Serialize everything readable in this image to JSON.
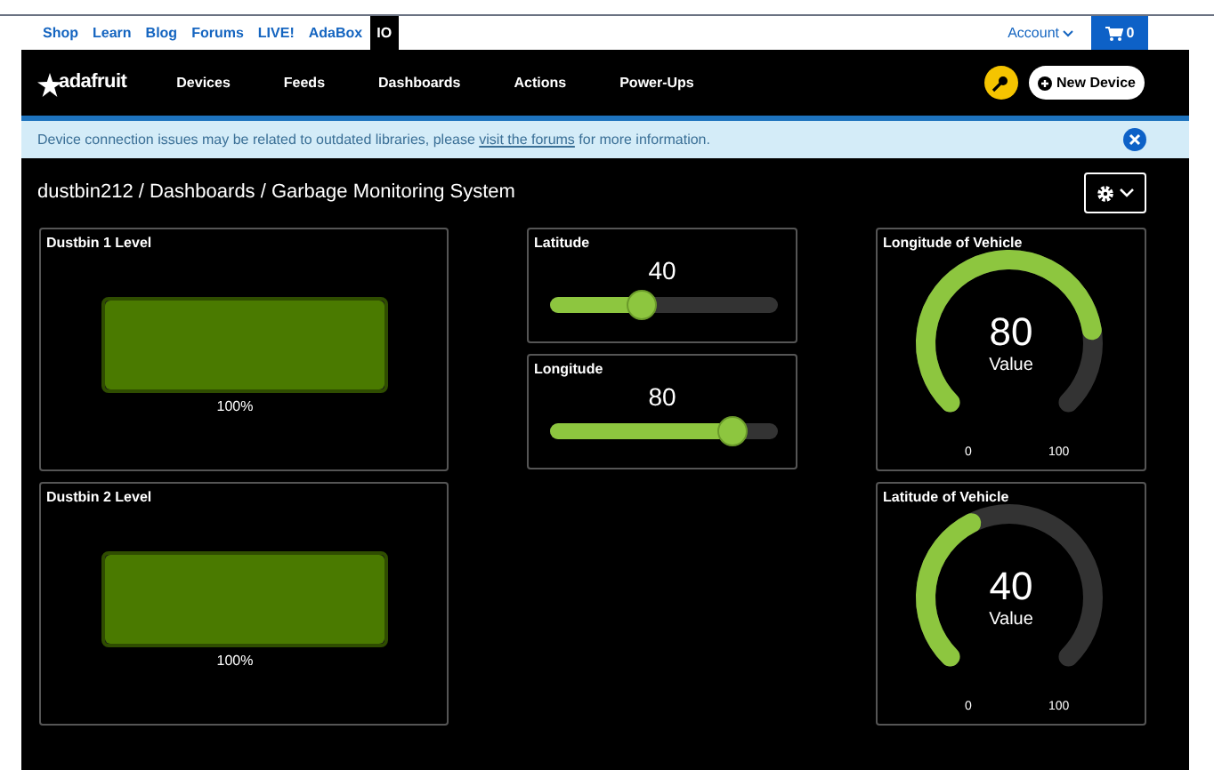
{
  "top_links": [
    {
      "label": "Shop",
      "selected": false
    },
    {
      "label": "Learn",
      "selected": false
    },
    {
      "label": "Blog",
      "selected": false
    },
    {
      "label": "Forums",
      "selected": false
    },
    {
      "label": "LIVE!",
      "selected": false
    },
    {
      "label": "AdaBox",
      "selected": false
    },
    {
      "label": "IO",
      "selected": true
    }
  ],
  "account": "Account",
  "cart_count": "0",
  "logo": "adafruit",
  "nav": [
    "Devices",
    "Feeds",
    "Dashboards",
    "Actions",
    "Power-Ups"
  ],
  "new_device": "New Device",
  "notice": {
    "before": "Device connection issues may be related to outdated libraries, please ",
    "link": "visit the forums",
    "after": " for more information."
  },
  "breadcrumb": "dustbin212 / Dashboards / Garbage Monitoring System",
  "columns": [
    {
      "widgets": [
        {
          "kind": "level",
          "title": "Dustbin 1 Level",
          "level": 1,
          "reading": "100%"
        },
        {
          "kind": "level",
          "title": "Dustbin 2 Level",
          "level": 1,
          "reading": "100%"
        }
      ]
    },
    {
      "widgets": [
        {
          "kind": "slider",
          "title": "Latitude",
          "reading": "40",
          "level": 0.4
        },
        {
          "kind": "slider",
          "title": "Longitude",
          "reading": "80",
          "level": 0.8
        }
      ]
    },
    {
      "widgets": [
        {
          "kind": "gauge",
          "title": "Longitude of Vehicle",
          "reading": "80",
          "unit": "Value",
          "min": "0",
          "max": "100"
        },
        {
          "kind": "gauge",
          "title": "Latitude of Vehicle",
          "reading": "40",
          "unit": "Value",
          "min": "0",
          "max": "100"
        }
      ]
    }
  ]
}
